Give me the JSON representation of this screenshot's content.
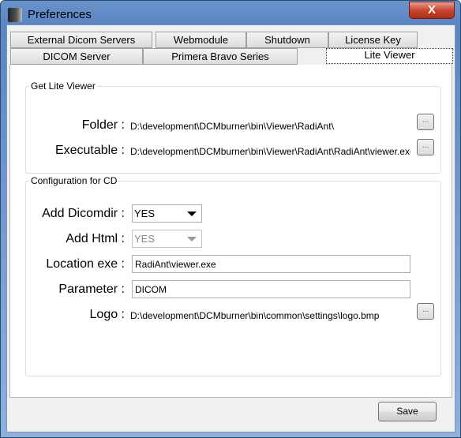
{
  "window": {
    "title": "Preferences",
    "close_label": "X"
  },
  "tabs_row1": [
    "External Dicom Servers",
    "Webmodule",
    "Shutdown",
    "License Key"
  ],
  "tabs_row2": [
    "DICOM Server",
    "Primera Bravo Series",
    "Lite Viewer"
  ],
  "active_tab": "Lite Viewer",
  "get_lite_viewer": {
    "title": "Get Lite Viewer",
    "folder_label": "Folder :",
    "folder_value": "D:\\development\\DCMburner\\bin\\Viewer\\RadiAnt\\",
    "executable_label": "Executable :",
    "executable_value": "D:\\development\\DCMburner\\bin\\Viewer\\RadiAnt\\RadiAnt\\viewer.exe",
    "browse_label": "..."
  },
  "config_cd": {
    "title": "Configuration for CD",
    "add_dicomdir_label": "Add Dicomdir :",
    "add_dicomdir_value": "YES",
    "add_html_label": "Add Html :",
    "add_html_value": "YES",
    "location_label": "Location exe :",
    "location_value": "RadiAnt\\viewer.exe",
    "parameter_label": "Parameter :",
    "parameter_value": "DICOM",
    "logo_label": "Logo :",
    "logo_value": "D:\\development\\DCMburner\\bin\\common\\settings\\logo.bmp",
    "browse_label": "..."
  },
  "save_label": "Save"
}
